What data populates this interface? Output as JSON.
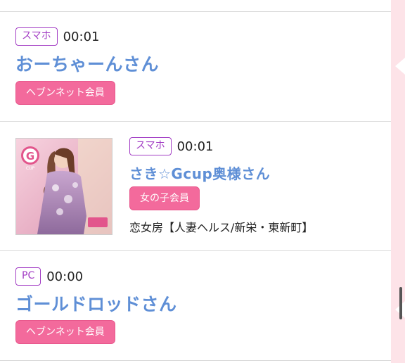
{
  "posts": [
    {
      "device": "スマホ",
      "time": "00:01",
      "name": "おーちゃーんさん",
      "member_label": "ヘブンネット会員"
    },
    {
      "device": "スマホ",
      "time": "00:01",
      "name": "さき☆Gcup奥様さん",
      "member_label": "女の子会員",
      "shop": "恋女房【人妻ヘルス/新栄・東新町】",
      "thumbnail_badge": "G",
      "thumbnail_badge_sub": "CUP"
    },
    {
      "device": "PC",
      "time": "00:00",
      "name": "ゴールドロッドさん",
      "member_label": "ヘブンネット会員"
    }
  ],
  "colors": {
    "name": "#5f8fd6",
    "badge_border": "#a23cc4",
    "member_badge": "#f36a9c",
    "side_strip": "#fde3e8"
  }
}
